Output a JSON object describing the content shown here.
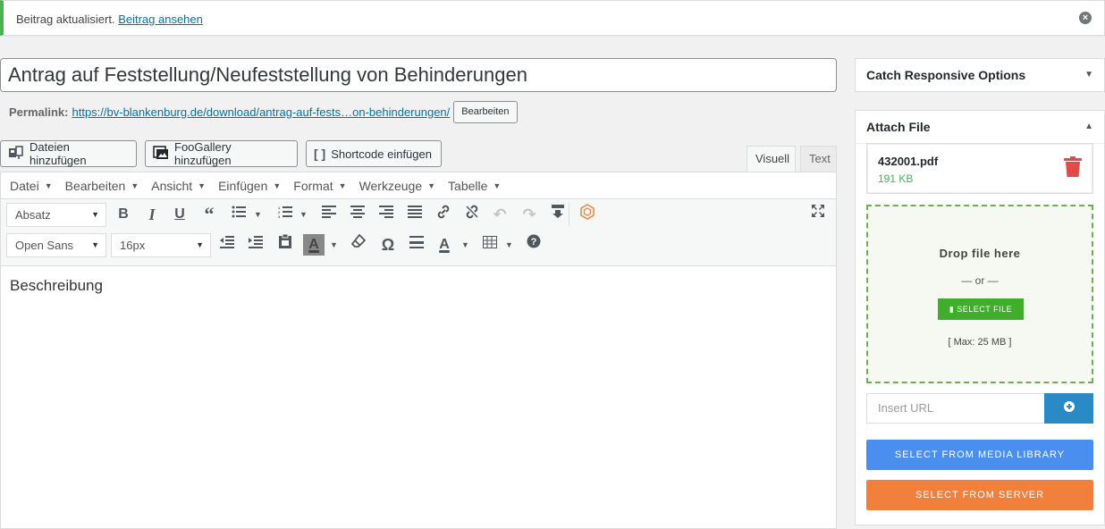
{
  "notice": {
    "message": "Beitrag aktualisiert.",
    "link": "Beitrag ansehen",
    "dismiss": "×"
  },
  "title": "Antrag auf Feststellung/Neufeststellung von Behinderungen",
  "permalink": {
    "label": "Permalink:",
    "url_prefix": "https://bv-blankenburg.de/download/",
    "url_slug": "antrag-auf-fests…on-behinderungen",
    "url_suffix": "/",
    "edit": "Bearbeiten"
  },
  "media_buttons": {
    "add_files": "Dateien hinzufügen",
    "foogallery": "FooGallery hinzufügen",
    "shortcode": "Shortcode einfügen"
  },
  "tabs": {
    "visual": "Visuell",
    "text": "Text"
  },
  "menubar": [
    "Datei",
    "Bearbeiten",
    "Ansicht",
    "Einfügen",
    "Format",
    "Werkzeuge",
    "Tabelle"
  ],
  "toolbar": {
    "block_format": "Absatz",
    "font_family": "Open Sans",
    "font_size": "16px"
  },
  "editor_content": "Beschreibung",
  "sidebar": {
    "catch_responsive": "Catch Responsive Options",
    "attach_file": "Attach File",
    "file_name": "432001.pdf",
    "file_size": "191 KB",
    "drop_title": "Drop file here",
    "drop_or": "— or —",
    "select_file": "SELECT FILE",
    "max_size": "[ Max: 25 MB ]",
    "insert_url_placeholder": "Insert URL",
    "media_library": "SELECT FROM MEDIA LIBRARY",
    "from_server": "SELECT FROM SERVER"
  },
  "colors": {
    "accent": "#0073aa",
    "success": "#46b450",
    "trash": "#e04a4a",
    "media_library": "#4a8ef0",
    "from_server": "#f0803c",
    "insert_btn": "#2a8ac6"
  }
}
